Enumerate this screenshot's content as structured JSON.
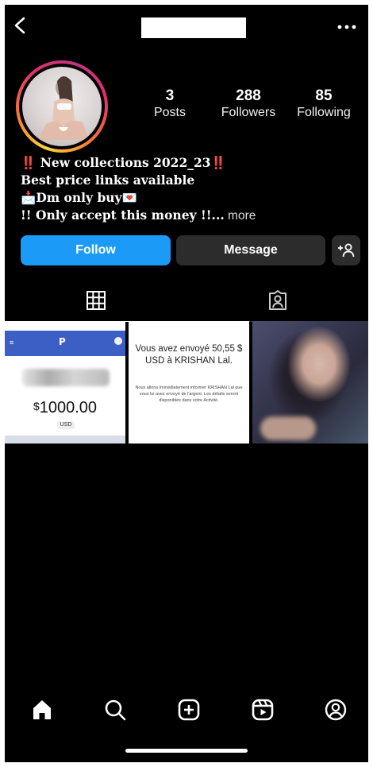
{
  "header": {
    "back_icon": "chevron-left-icon",
    "username_redacted": true,
    "more_icon": "ellipsis-horizontal-icon"
  },
  "profile": {
    "stats": [
      {
        "value": "3",
        "label": "Posts"
      },
      {
        "value": "288",
        "label": "Followers"
      },
      {
        "value": "85",
        "label": "Following"
      }
    ]
  },
  "bio": {
    "line1_prefix": "‼️",
    "line1_text": " New collections 2022_23",
    "line1_suffix": "‼️",
    "line2": "Best price links available",
    "line3_icon": "📩",
    "line3_text": "Dm only buy",
    "line3_suffix": "💌",
    "line4_text": "!! Only accept this money !!...",
    "more": " more"
  },
  "actions": {
    "follow": "Follow",
    "message": "Message",
    "add_user_icon": "add-person-icon"
  },
  "tabs": [
    {
      "icon": "grid-icon",
      "active": true
    },
    {
      "icon": "tagged-person-icon",
      "active": false
    }
  ],
  "posts": {
    "post1": {
      "amount_symbol": "$",
      "amount": "1000.00",
      "currency": "USD"
    },
    "post2": {
      "title": "Vous avez envoyé 50,55 $ USD à KRISHAN Lal.",
      "body": "Nous allons immédiatement informer KRISHAN Lal que vous lui avez envoyé de l'argent. Les détails seront disponibles dans votre Activité."
    }
  },
  "bottom_nav": [
    {
      "icon": "home-icon"
    },
    {
      "icon": "search-icon"
    },
    {
      "icon": "create-post-icon"
    },
    {
      "icon": "reels-icon"
    },
    {
      "icon": "profile-icon"
    }
  ],
  "colors": {
    "follow_button": "#1b9bf7",
    "secondary_button": "#2c2c2c",
    "background": "#000000",
    "paypal_blue": "#3b5fc4"
  }
}
